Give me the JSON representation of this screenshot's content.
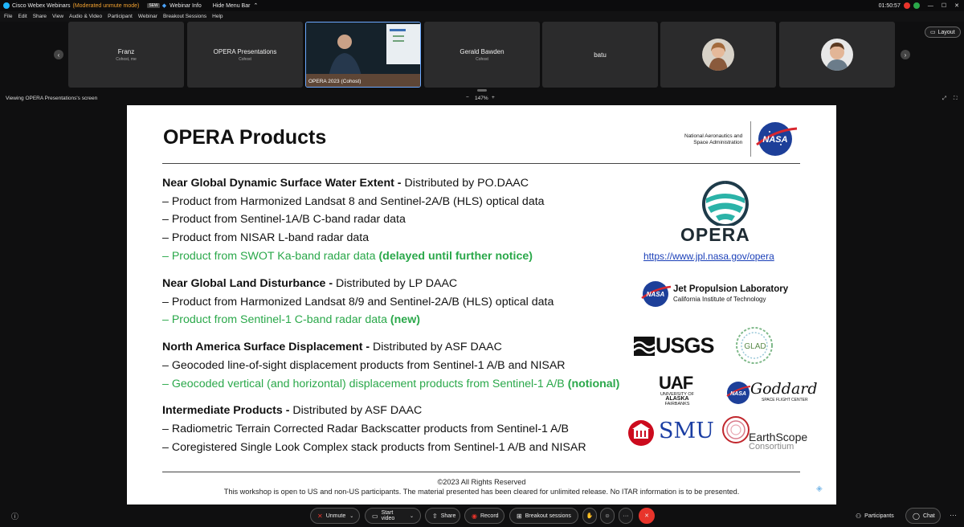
{
  "titlebar": {
    "app": "Cisco Webex Webinars",
    "mode": "(Moderated unmute mode)",
    "badge": "SEW",
    "webinar_info": "Webinar Info",
    "hide_menu": "Hide Menu Bar",
    "time": "01:50:57"
  },
  "menu": [
    "File",
    "Edit",
    "Share",
    "View",
    "Audio & Video",
    "Participant",
    "Webinar",
    "Breakout Sessions",
    "Help"
  ],
  "strip": {
    "layout_label": "Layout",
    "tiles": [
      {
        "name": "Franz",
        "role": "Cohost, me"
      },
      {
        "name": "OPERA Presentations",
        "role": "Cohost"
      },
      {
        "name": "OPERA 2023 (Cohost)",
        "role": ""
      },
      {
        "name": "Gerald Bawden",
        "role": "Cohost"
      },
      {
        "name": "batu",
        "role": ""
      }
    ]
  },
  "viewing": "Viewing OPERA Presentations's screen",
  "zoom": "147%",
  "slide": {
    "title": "OPERA Products",
    "nasa_line1": "National Aeronautics and",
    "nasa_line2": "Space Administration",
    "nasa_logo": "NASA",
    "opera_logo": "OPERA",
    "opera_url": "https://www.jpl.nasa.gov/opera",
    "jpl_line1": "Jet Propulsion Laboratory",
    "jpl_line2": "California Institute of Technology",
    "usgs": "USGS",
    "glad": "GLAD",
    "uaf": "UAF",
    "uaf_sub1": "UNIVERSITY OF",
    "uaf_sub2": "ALASKA",
    "uaf_sub3": "FAIRBANKS",
    "goddard": "Goddard",
    "goddard_sub": "SPACE FLIGHT CENTER",
    "smu": "SMU",
    "earthscope1": "EarthScope",
    "earthscope2": "Consortium",
    "sec1": {
      "head": "Near Global Dynamic Surface Water Extent -",
      "dist": " Distributed by PO.DAAC",
      "l1": "– Product from Harmonized Landsat 8 and Sentinel-2A/B (HLS) optical data",
      "l2": "– Product from Sentinel-1A/B C-band radar data",
      "l3": "– Product from NISAR L-band radar data",
      "l4": "– Product from SWOT Ka-band radar data ",
      "l4b": "(delayed until further notice)"
    },
    "sec2": {
      "head": "Near Global Land Disturbance -",
      "dist": " Distributed by LP DAAC",
      "l1": "– Product from Harmonized Landsat 8/9 and Sentinel-2A/B (HLS) optical data",
      "l2": "– Product from Sentinel-1 C-band radar data ",
      "l2b": "(new)"
    },
    "sec3": {
      "head": "North America Surface Displacement -",
      "dist": " Distributed by ASF DAAC",
      "l1": "– Geocoded line-of-sight displacement products from Sentinel-1 A/B and NISAR",
      "l2": "– Geocoded vertical (and horizontal) displacement products from Sentinel-1 A/B ",
      "l2b": "(notional)"
    },
    "sec4": {
      "head": "Intermediate Products -",
      "dist": " Distributed by ASF DAAC",
      "l1": "– Radiometric Terrain Corrected Radar Backscatter products from Sentinel-1 A/B",
      "l2": "– Coregistered Single Look Complex stack products from Sentinel-1 A/B and NISAR"
    },
    "copyright": "©2023 All Rights Reserved",
    "disclaimer": "This workshop is open to US and non-US participants. The material presented has been cleared for unlimited release. No ITAR information is to be presented."
  },
  "controls": {
    "unmute": "Unmute",
    "start_video": "Start video",
    "share": "Share",
    "record": "Record",
    "breakout": "Breakout sessions",
    "more": "···",
    "participants": "Participants",
    "chat": "Chat"
  },
  "colors": {
    "green": "#2aa84a",
    "red_leave": "#e8342b",
    "accent": "#1fb6ff"
  }
}
